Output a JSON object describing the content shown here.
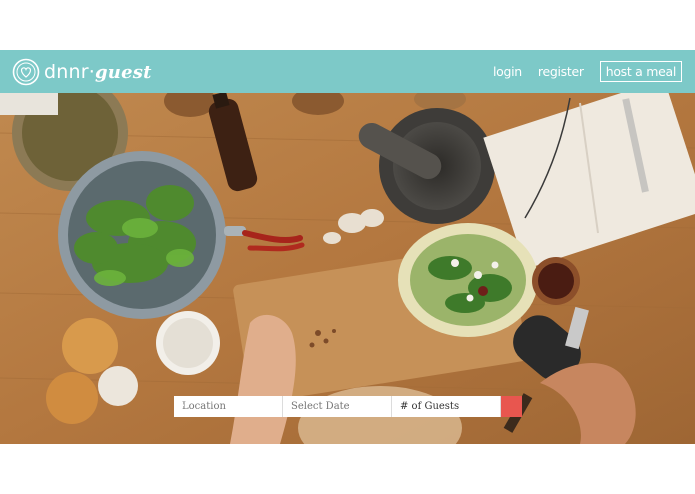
{
  "brand": {
    "name": "dnnr",
    "name_suffix": "guest",
    "accent_color": "#7dc9c8"
  },
  "nav": {
    "login": "login",
    "register": "register",
    "host": "host a meal"
  },
  "search": {
    "location_placeholder": "Location",
    "date_placeholder": "Select Date",
    "guests_value": "# of Guests",
    "button_icon": "search-icon",
    "button_color": "#e8564f"
  },
  "hero": {
    "image_subject": "overhead view of kitchen table with salad, herbs and cooking ingredients"
  }
}
